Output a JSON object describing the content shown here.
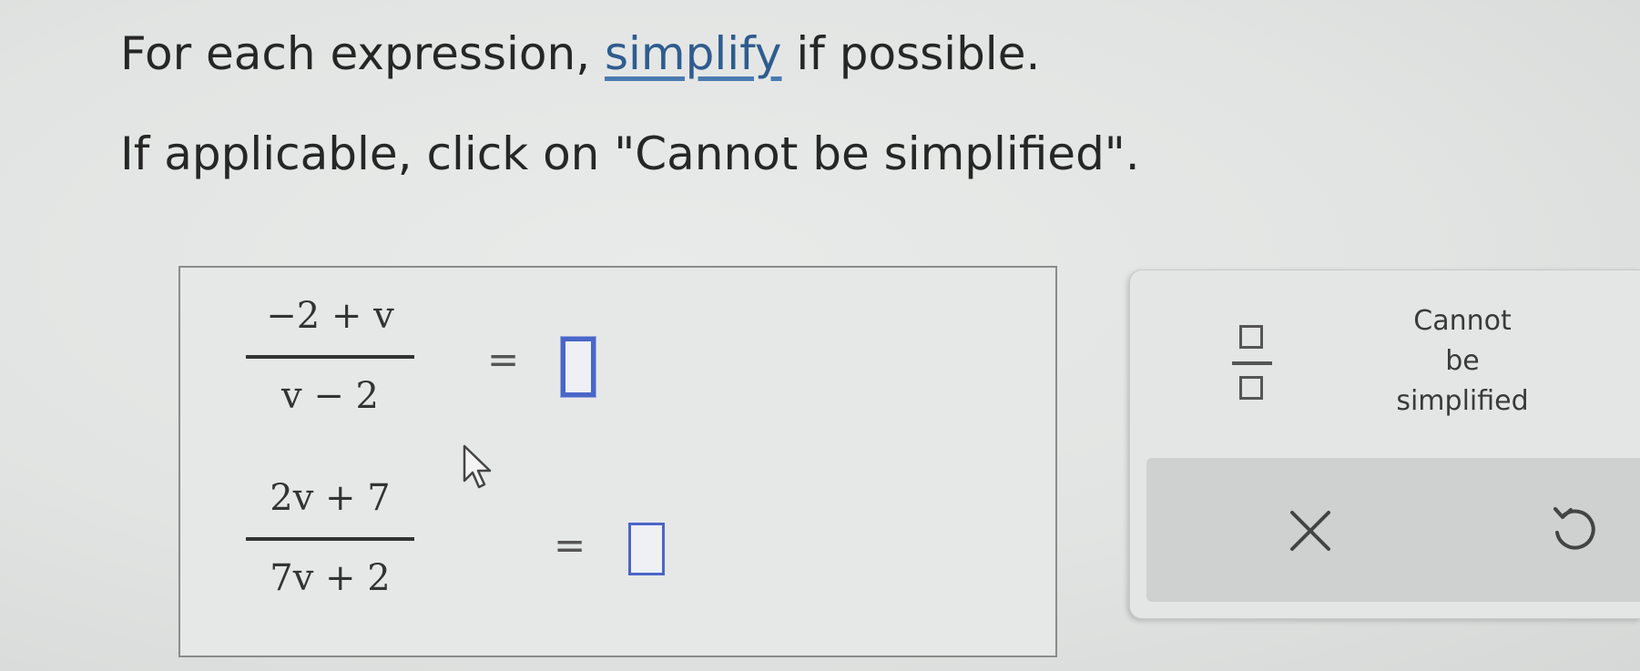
{
  "instructions": {
    "line1_prefix": "For each expression, ",
    "line1_link": "simplify",
    "line1_suffix": " if possible.",
    "line2": "If applicable, click on \"Cannot be simplified\"."
  },
  "expressions": [
    {
      "numerator": "−2 + v",
      "denominator": "v − 2",
      "equals": "=",
      "answer": ""
    },
    {
      "numerator": "2v + 7",
      "denominator": "7v + 2",
      "equals": "=",
      "answer": ""
    }
  ],
  "toolbar": {
    "fraction_button": "fraction-template",
    "cannot_simplify_lines": [
      "Cannot",
      "be",
      "simplified"
    ],
    "clear_icon": "x-icon",
    "undo_icon": "undo-icon"
  },
  "colors": {
    "link": "#2f5c8f",
    "answer_box_border": "#4a66c7"
  }
}
